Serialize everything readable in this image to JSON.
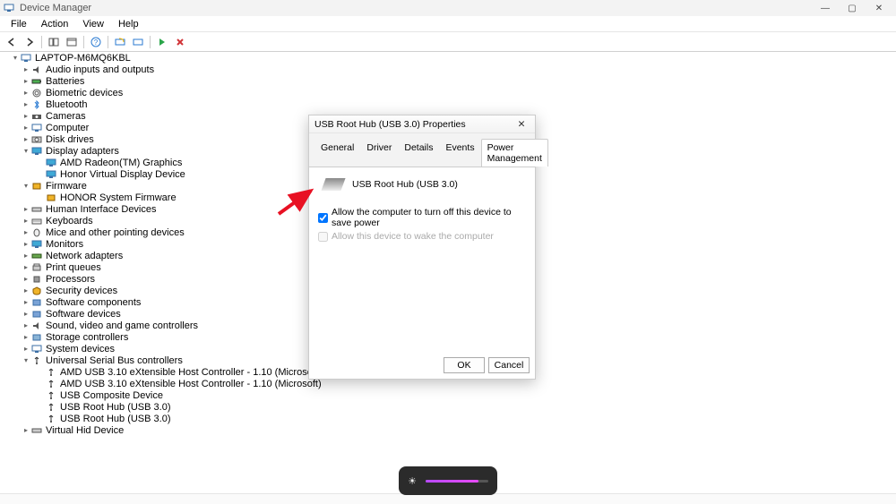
{
  "window": {
    "title": "Device Manager"
  },
  "menubar": {
    "file": "File",
    "action": "Action",
    "view": "View",
    "help": "Help"
  },
  "tree": {
    "root": "LAPTOP-M6MQ6KBL",
    "audio": "Audio inputs and outputs",
    "batteries": "Batteries",
    "biometric": "Biometric devices",
    "bluetooth": "Bluetooth",
    "cameras": "Cameras",
    "computer": "Computer",
    "disk": "Disk drives",
    "display": "Display adapters",
    "display_child1": "AMD Radeon(TM) Graphics",
    "display_child2": "Honor Virtual Display Device",
    "firmware": "Firmware",
    "firmware_child1": "HONOR System Firmware",
    "hid": "Human Interface Devices",
    "keyboards": "Keyboards",
    "mice": "Mice and other pointing devices",
    "monitors": "Monitors",
    "network": "Network adapters",
    "printqueues": "Print queues",
    "processors": "Processors",
    "security": "Security devices",
    "swcomp": "Software components",
    "swdev": "Software devices",
    "sound": "Sound, video and game controllers",
    "storage": "Storage controllers",
    "system": "System devices",
    "usb": "Universal Serial Bus controllers",
    "usb_c1": "AMD USB 3.10 eXtensible Host Controller - 1.10 (Microsoft)",
    "usb_c2": "AMD USB 3.10 eXtensible Host Controller - 1.10 (Microsoft)",
    "usb_c3": "USB Composite Device",
    "usb_c4": "USB Root Hub (USB 3.0)",
    "usb_c5": "USB Root Hub (USB 3.0)",
    "vhid": "Virtual Hid Device"
  },
  "dialog": {
    "title": "USB Root Hub (USB 3.0) Properties",
    "tabs": {
      "general": "General",
      "driver": "Driver",
      "details": "Details",
      "events": "Events",
      "power": "Power Management"
    },
    "device_name": "USB Root Hub (USB 3.0)",
    "check1": "Allow the computer to turn off this device to save power",
    "check2": "Allow this device to wake the computer",
    "ok": "OK",
    "cancel": "Cancel"
  }
}
